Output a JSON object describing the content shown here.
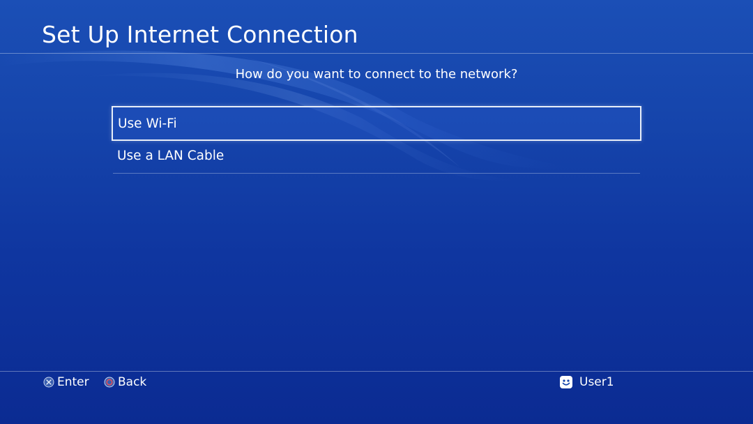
{
  "header": {
    "title": "Set Up Internet Connection"
  },
  "prompt": "How do you want to connect to the network?",
  "options": [
    {
      "label": "Use Wi-Fi",
      "selected": true
    },
    {
      "label": "Use a LAN Cable",
      "selected": false
    }
  ],
  "footer": {
    "hints": [
      {
        "icon": "cross-button-icon",
        "label": "Enter"
      },
      {
        "icon": "circle-button-icon",
        "label": "Back"
      }
    ],
    "user": {
      "icon": "smiley-avatar-icon",
      "name": "User1"
    }
  },
  "colors": {
    "background_top": "#1b4fb6",
    "background_bottom": "#0b2b92",
    "selection_border": "#e8eef8",
    "circle_button": "#e0505a"
  }
}
